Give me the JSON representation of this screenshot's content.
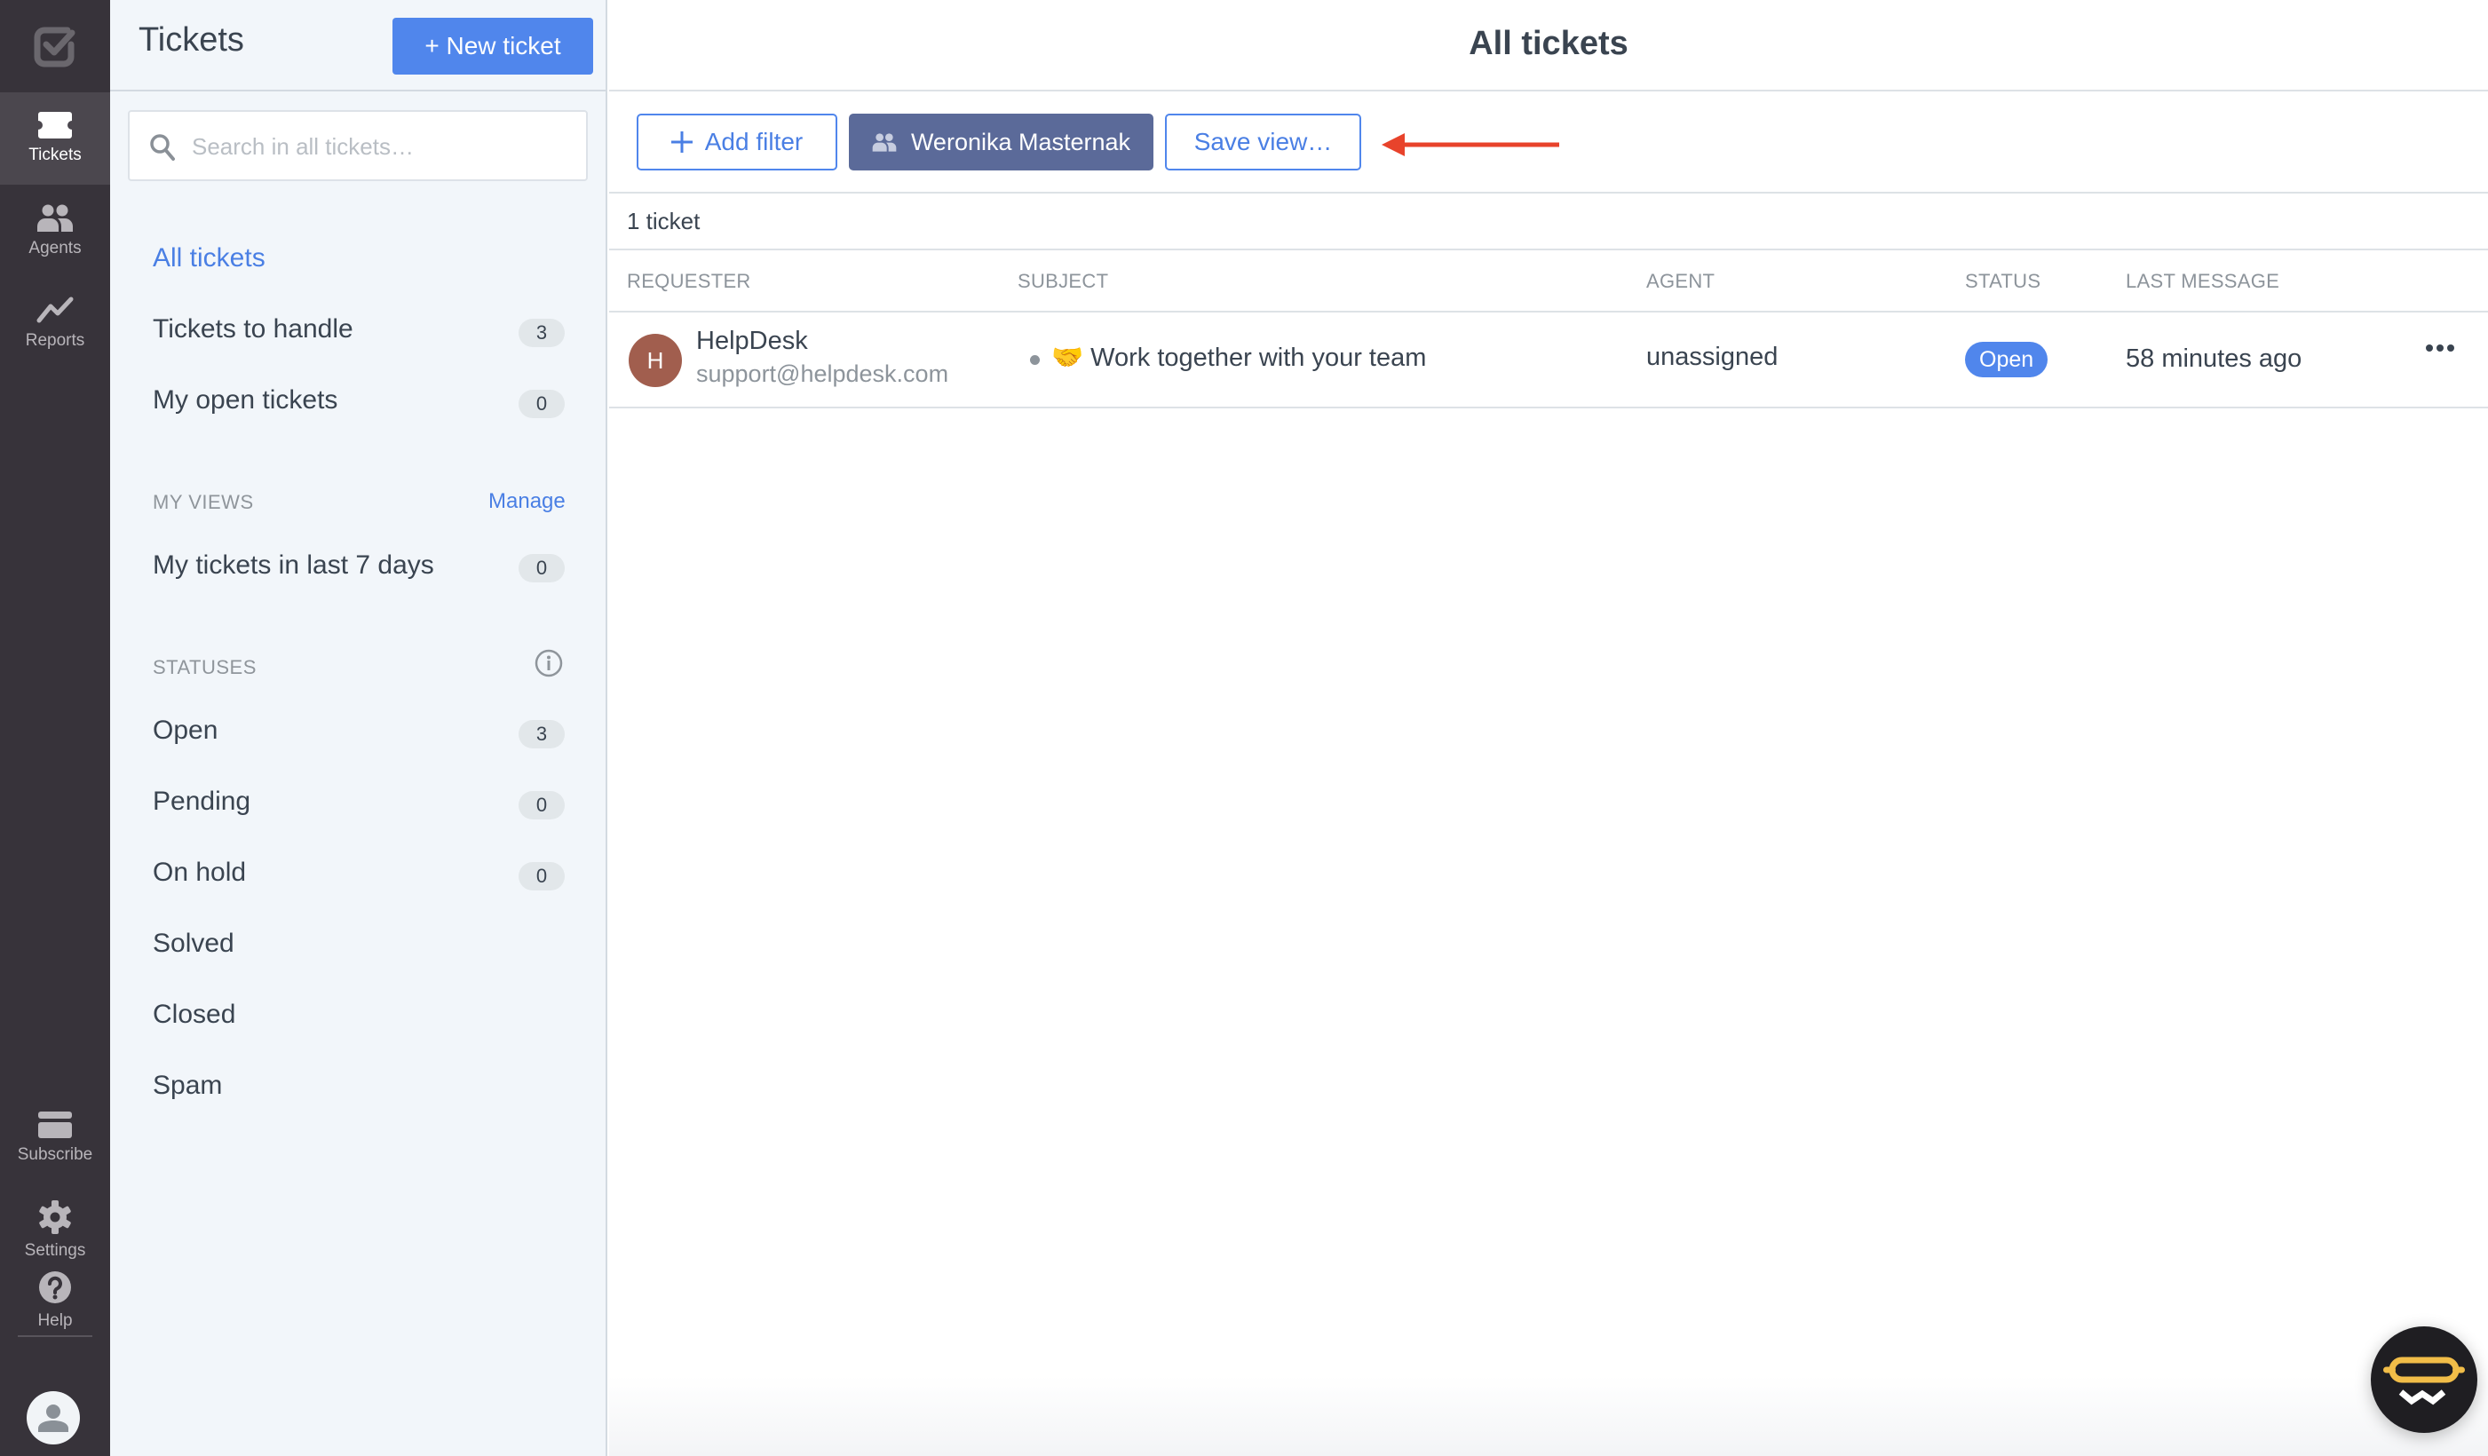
{
  "rail": {
    "logo_icon": "checkbox-logo-icon",
    "items": [
      {
        "label": "Tickets",
        "icon": "ticket-icon",
        "active": true
      },
      {
        "label": "Agents",
        "icon": "people-icon",
        "active": false
      },
      {
        "label": "Reports",
        "icon": "chart-line-icon",
        "active": false
      }
    ],
    "bottom_items": [
      {
        "label": "Subscribe",
        "icon": "card-icon"
      },
      {
        "label": "Settings",
        "icon": "gear-icon"
      },
      {
        "label": "Help",
        "icon": "help-icon"
      }
    ],
    "avatar_icon": "user-avatar-icon"
  },
  "panel": {
    "title": "Tickets",
    "new_ticket_label": "+ New ticket",
    "search_placeholder": "Search in all tickets…",
    "links": [
      {
        "label": "All tickets",
        "active": true
      },
      {
        "label": "Tickets to handle",
        "count": "3"
      },
      {
        "label": "My open tickets",
        "count": "0"
      }
    ],
    "my_views": {
      "label": "MY VIEWS",
      "manage_label": "Manage",
      "items": [
        {
          "label": "My tickets in last 7 days",
          "count": "0"
        }
      ]
    },
    "statuses": {
      "label": "STATUSES",
      "items": [
        {
          "label": "Open",
          "count": "3"
        },
        {
          "label": "Pending",
          "count": "0"
        },
        {
          "label": "On hold",
          "count": "0"
        },
        {
          "label": "Solved"
        },
        {
          "label": "Closed"
        },
        {
          "label": "Spam"
        }
      ]
    }
  },
  "main": {
    "title": "All tickets",
    "filters": {
      "add_filter_label": "Add filter",
      "active_filter_label": "Weronika Masternak",
      "save_view_label": "Save view…"
    },
    "ticket_count": "1 ticket",
    "columns": [
      "REQUESTER",
      "SUBJECT",
      "AGENT",
      "STATUS",
      "LAST MESSAGE"
    ],
    "rows": [
      {
        "avatar_initial": "H",
        "requester_name": "HelpDesk",
        "requester_email": "support@helpdesk.com",
        "subject_emoji": "🤝",
        "subject": "Work together with your team",
        "agent": "unassigned",
        "status": "Open",
        "last_message": "58 minutes ago"
      }
    ]
  },
  "colors": {
    "accent": "#5086ec",
    "rail_bg": "#37333a",
    "panel_bg": "#f2f6fa",
    "filter_chip": "#5b6a99",
    "annotation_arrow": "#e8432b",
    "avatar_bg": "#a15e4e"
  }
}
